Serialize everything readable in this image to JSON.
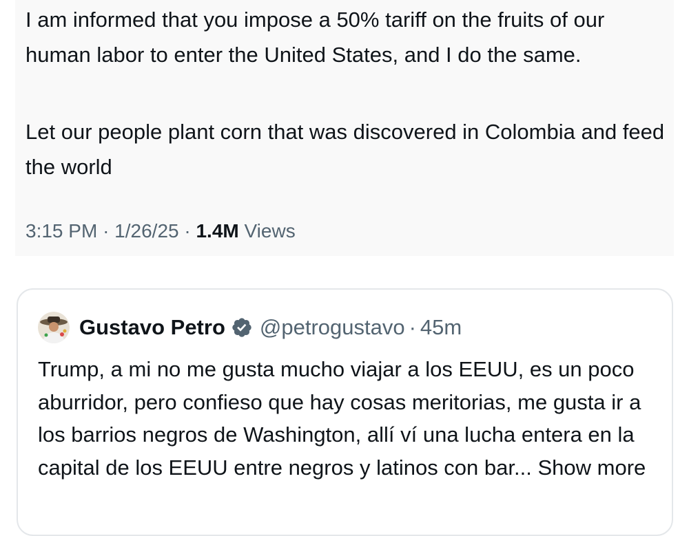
{
  "tweet": {
    "paragraphs": [
      "I am informed that you impose a 50% tariff on the fruits of our human labor to enter the United States, and I do the same.",
      "Let our people plant corn that was discovered in Colombia and feed the world"
    ],
    "time": "3:15 PM",
    "separator": "·",
    "date": "1/26/25",
    "views_count": "1.4M",
    "views_label": "Views"
  },
  "quote": {
    "display_name": "Gustavo Petro",
    "handle": "@petrogustavo",
    "separator": "·",
    "time": "45m",
    "text": "Trump, a mi no me gusta mucho viajar a los EEUU, es un poco aburridor, pero confieso que hay cosas meritorias, me gusta ir a los barrios negros de Washington, allí ví una lucha entera en la capital de los EEUU entre negros y latinos con bar...",
    "show_more": "Show more",
    "icons": {
      "avatar": "avatar-image",
      "verified": "verified-badge-icon"
    },
    "verified_color": "#536471"
  },
  "colors": {
    "text_primary": "#0f1419",
    "text_secondary": "#536471",
    "card_border": "#e4e7ea",
    "tweet_background": "#f9f9f9"
  }
}
